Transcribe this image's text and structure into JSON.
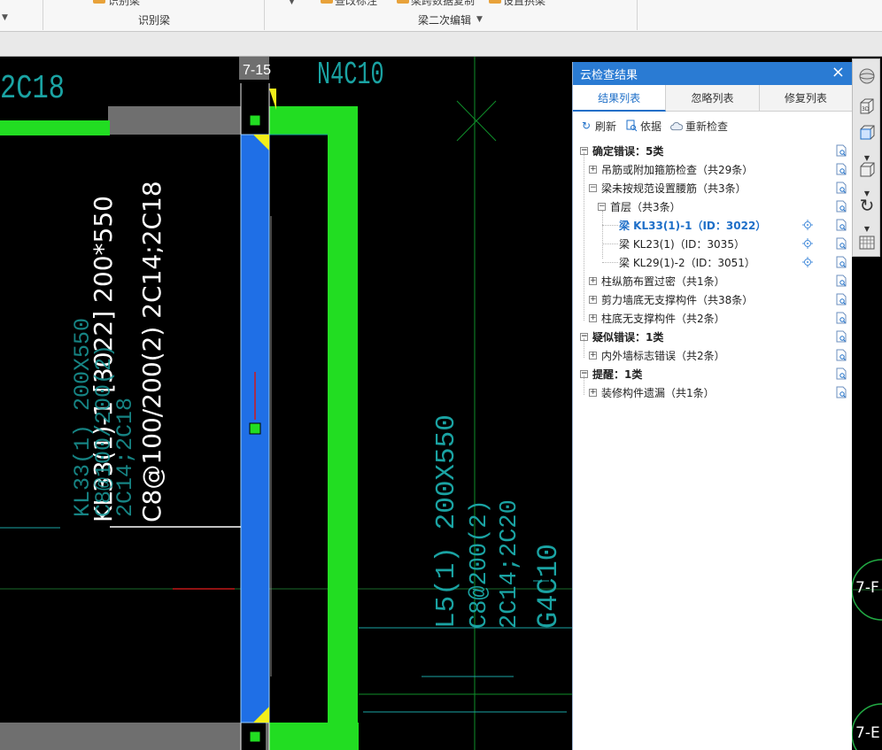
{
  "ribbon": {
    "group1_label": "识别梁",
    "group2_label": "梁二次编辑",
    "cut_text_1": "识别梁",
    "cut_text_2": "查改标注",
    "cut_text_3": "梁跨数据复制",
    "cut_text_4": "设置拱梁"
  },
  "canvas": {
    "grid_top_label": "7-15",
    "beam_main_label_line1": "KL33(1)-1 [3022] 200*550",
    "beam_main_label_line2": "C8@100/200(2) 2C14;2C18",
    "top_left_text": "2C18",
    "top_mid_text": "N4C10",
    "ghost_left_line1": "KL33(1) 200X550",
    "ghost_left_line2": "C8@100/200(2)",
    "ghost_left_line3": "2C14;2C18",
    "ghost_right_line1": "L5(1) 200X550",
    "ghost_right_line2": "C8@200(2)",
    "ghost_right_line3": "2C14;2C20",
    "ghost_right_line4": "G4C10"
  },
  "strip": {
    "axis_label_1": "7-F",
    "axis_label_2": "7-E"
  },
  "panel": {
    "title": "云检查结果",
    "close_icon": "close-icon",
    "tabs": [
      {
        "label": "结果列表",
        "active": true
      },
      {
        "label": "忽略列表",
        "active": false
      },
      {
        "label": "修复列表",
        "active": false
      }
    ],
    "actions": {
      "refresh": "刷新",
      "basis": "依据",
      "recheck": "重新检查"
    },
    "tree": [
      {
        "label": "确定错误：5类",
        "level": 0,
        "toggle": "−",
        "bold": true
      },
      {
        "label": "吊筋或附加箍筋检查（共29条）",
        "level": 1,
        "toggle": "+"
      },
      {
        "label": "梁未按规范设置腰筋（共3条）",
        "level": 1,
        "toggle": "−"
      },
      {
        "label": "首层（共3条）",
        "level": 2,
        "toggle": "−"
      },
      {
        "label": "梁 KL33(1)-1（ID：3022）",
        "level": 3,
        "selected": true,
        "locate": true
      },
      {
        "label": "梁 KL23(1)（ID：3035）",
        "level": 3,
        "locate": true
      },
      {
        "label": "梁 KL29(1)-2（ID：3051）",
        "level": 3,
        "locate": true
      },
      {
        "label": "柱纵筋布置过密（共1条）",
        "level": 1,
        "toggle": "+"
      },
      {
        "label": "剪力墙底无支撑构件（共38条）",
        "level": 1,
        "toggle": "+"
      },
      {
        "label": "柱底无支撑构件（共2条）",
        "level": 1,
        "toggle": "+"
      },
      {
        "label": "疑似错误：1类",
        "level": 0,
        "toggle": "−",
        "bold": true
      },
      {
        "label": "内外墙标志错误（共2条）",
        "level": 1,
        "toggle": "+"
      },
      {
        "label": "提醒：1类",
        "level": 0,
        "toggle": "−",
        "bold": true
      },
      {
        "label": "装修构件遗漏（共1条）",
        "level": 1,
        "toggle": "+"
      }
    ]
  },
  "colors": {
    "panel_header": "#2a7bd3",
    "selected_text": "#1e6fc8",
    "beam_green": "#22dd22",
    "beam_blue": "#1f6fe6",
    "gray_beam": "#6f6f6f",
    "cad_cyan": "#1aa3a3",
    "cad_line_green": "#0f8f2a"
  }
}
